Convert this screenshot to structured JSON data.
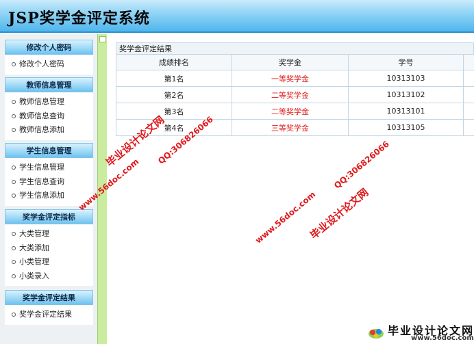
{
  "app": {
    "title": "JSP奖学金评定系统"
  },
  "sidebar": {
    "sections": [
      {
        "title": "修改个人密码",
        "items": [
          "修改个人密码"
        ]
      },
      {
        "title": "教师信息管理",
        "items": [
          "教师信息管理",
          "教师信息查询",
          "教师信息添加"
        ]
      },
      {
        "title": "学生信息管理",
        "items": [
          "学生信息管理",
          "学生信息查询",
          "学生信息添加"
        ]
      },
      {
        "title": "奖学金评定指标",
        "items": [
          "大类管理",
          "大类添加",
          "小类管理",
          "小类录入"
        ]
      },
      {
        "title": "奖学金评定结果",
        "items": [
          "奖学金评定结果"
        ]
      }
    ]
  },
  "results": {
    "panel_title": "奖学金评定结果",
    "columns": [
      "成绩排名",
      "奖学金",
      "学号"
    ],
    "rows": [
      {
        "rank": "第1名",
        "award": "一等奖学金",
        "student_id": "10313103"
      },
      {
        "rank": "第2名",
        "award": "二等奖学金",
        "student_id": "10313102"
      },
      {
        "rank": "第3名",
        "award": "二等奖学金",
        "student_id": "10313101"
      },
      {
        "rank": "第4名",
        "award": "三等奖学金",
        "student_id": "10313105"
      }
    ],
    "award_color": "#e02020"
  },
  "watermarks": {
    "brand": "毕业设计论文网",
    "qq": "QQ:306826066",
    "url": "www.56doc.com",
    "footer_brand": "毕业设计论文网",
    "footer_url": "www.56doc.com"
  },
  "colors": {
    "header_gradient_end": "#4fb6ec",
    "divider_green": "#c9ec9e",
    "watermark_red": "#e0191c"
  }
}
